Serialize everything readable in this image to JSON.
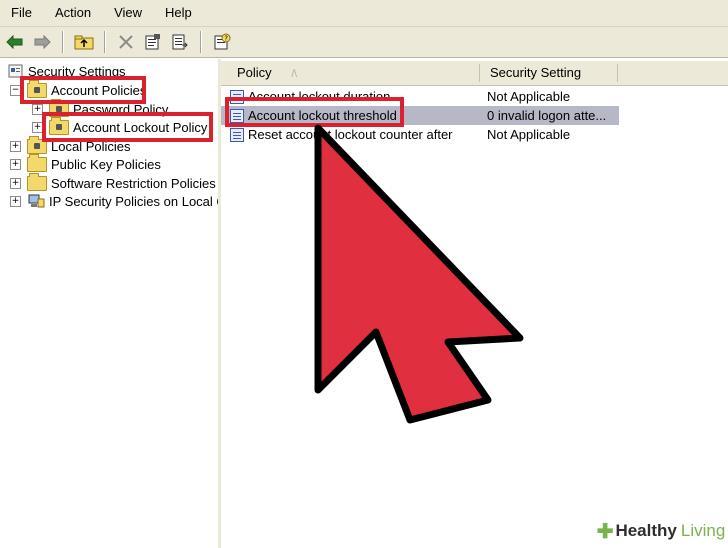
{
  "menu": {
    "items": [
      "File",
      "Action",
      "View",
      "Help"
    ]
  },
  "toolbar": {
    "buttons": [
      "back-arrow-icon",
      "forward-arrow-icon",
      "up-folder-icon",
      "delete-icon",
      "properties-icon",
      "export-list-icon",
      "help-icon"
    ]
  },
  "tree": {
    "root": "Security Settings",
    "account_policies": "Account Policies",
    "password_policy": "Password Policy",
    "account_lockout_policy": "Account Lockout Policy",
    "local_policies": "Local Policies",
    "public_key_policies": "Public Key Policies",
    "software_restriction_policies": "Software Restriction Policies",
    "ip_security_policies": "IP Security Policies on Local Co"
  },
  "list": {
    "headers": {
      "policy": "Policy",
      "setting": "Security Setting"
    },
    "rows": [
      {
        "policy": "Account lockout duration",
        "setting": "Not Applicable"
      },
      {
        "policy": "Account lockout threshold",
        "setting": "0 invalid logon atte..."
      },
      {
        "policy": "Reset account lockout counter after",
        "setting": "Not Applicable"
      }
    ]
  },
  "watermark": {
    "healthy": "Healthy",
    "living": "Living"
  },
  "colors": {
    "highlight_red": "#d9222e",
    "arrow_red": "#e0303f",
    "selection": "#b7b8c5",
    "chrome": "#ece9d8"
  }
}
